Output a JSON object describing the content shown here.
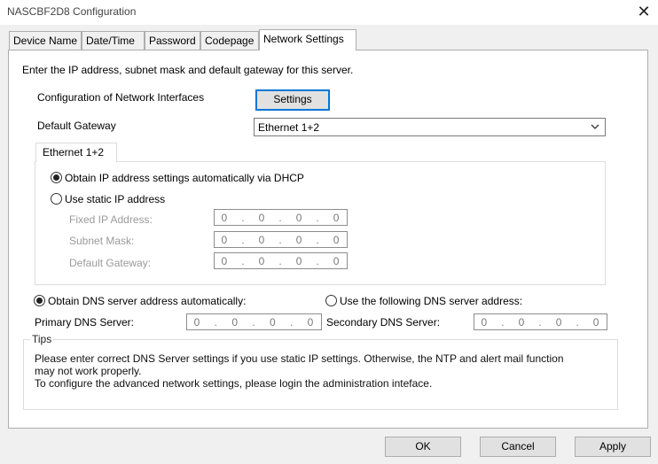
{
  "window": {
    "title": "NASCBF2D8 Configuration",
    "close_glyph": "✕"
  },
  "tabs": [
    {
      "label": "Device Name"
    },
    {
      "label": "Date/Time"
    },
    {
      "label": "Password"
    },
    {
      "label": "Codepage"
    },
    {
      "label": "Network Settings"
    }
  ],
  "active_tab": "Network Settings",
  "intro": "Enter the IP address, subnet mask and default gateway for this server.",
  "interfaces": {
    "label": "Configuration of Network Interfaces",
    "button": "Settings"
  },
  "gateway": {
    "label": "Default Gateway",
    "value": "Ethernet 1+2"
  },
  "ethernet": {
    "tab_label": "Ethernet 1+2",
    "dhcp_label": "Obtain IP address settings automatically via DHCP",
    "dhcp_selected": true,
    "static_label": "Use static IP address",
    "static_selected": false,
    "fixed_ip_label": "Fixed IP Address:",
    "subnet_label": "Subnet Mask:",
    "gateway_label": "Default Gateway:",
    "fixed_ip": [
      "0",
      "0",
      "0",
      "0"
    ],
    "subnet": [
      "0",
      "0",
      "0",
      "0"
    ],
    "gw": [
      "0",
      "0",
      "0",
      "0"
    ]
  },
  "dns": {
    "auto_label": "Obtain DNS server address automatically:",
    "auto_selected": true,
    "manual_label": "Use the following DNS server address:",
    "manual_selected": false,
    "primary_label": "Primary DNS Server:",
    "secondary_label": "Secondary DNS Server:",
    "primary": [
      "0",
      "0",
      "0",
      "0"
    ],
    "secondary": [
      "0",
      "0",
      "0",
      "0"
    ]
  },
  "tips": {
    "legend": "Tips",
    "line1": "Please enter correct DNS Server settings if you use static IP settings.  Otherwise, the NTP and alert mail function",
    "line2": "may not work properly.",
    "line3": "To configure the advanced network settings, please login the administration inteface."
  },
  "footer": {
    "ok": "OK",
    "cancel": "Cancel",
    "apply": "Apply"
  },
  "colors": {
    "focus_border": "#0078d7",
    "dialog_bg": "#f0f0f0"
  }
}
